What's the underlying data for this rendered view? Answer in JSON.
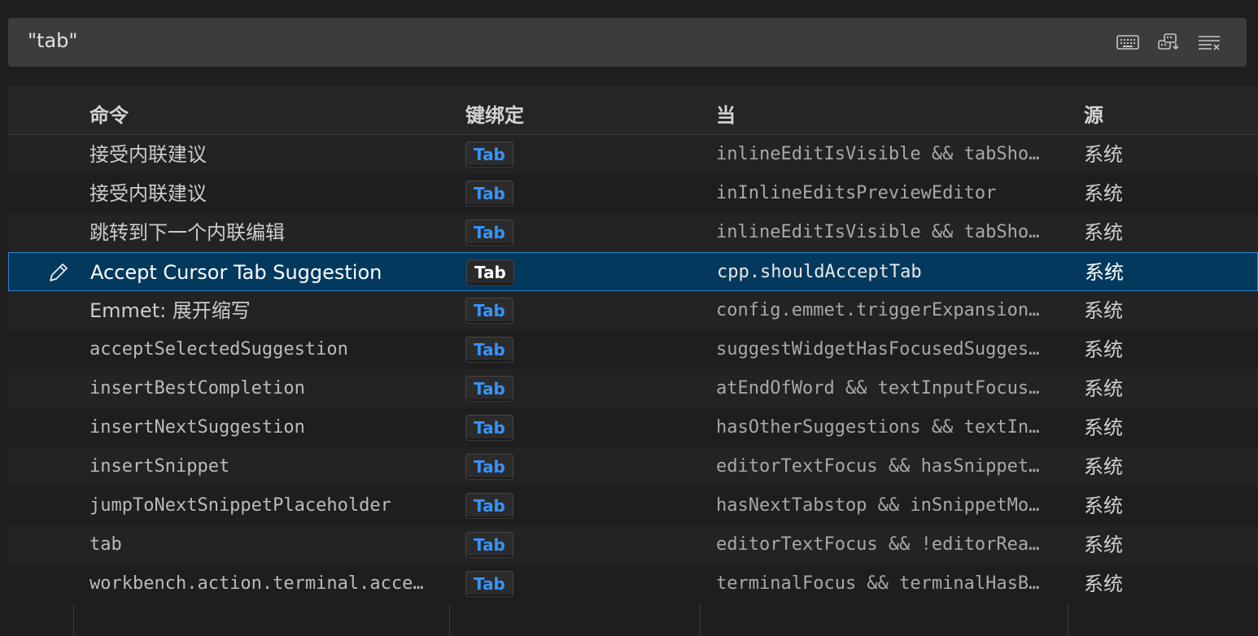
{
  "search": {
    "value": "\"tab\"",
    "record_keys_icon": "keyboard-icon",
    "sort_by_precedence_icon": "sort-precedence-icon",
    "clear_icon": "clear-filter-icon"
  },
  "table": {
    "headers": {
      "command": "命令",
      "keybinding": "键绑定",
      "when": "当",
      "source": "源"
    },
    "rows": [
      {
        "command": "接受内联建议",
        "key": "Tab",
        "when": "inlineEditIsVisible && tabSho…",
        "source": "系统"
      },
      {
        "command": "接受内联建议",
        "key": "Tab",
        "when": "inInlineEditsPreviewEditor",
        "source": "系统"
      },
      {
        "command": "跳转到下一个内联编辑",
        "key": "Tab",
        "when": "inlineEditIsVisible && tabSho…",
        "source": "系统"
      },
      {
        "command": "Accept Cursor Tab Suggestion",
        "key": "Tab",
        "when": "cpp.shouldAcceptTab",
        "source": "系统"
      },
      {
        "command": "Emmet: 展开缩写",
        "key": "Tab",
        "when": "config.emmet.triggerExpansion…",
        "source": "系统"
      },
      {
        "command": "acceptSelectedSuggestion",
        "key": "Tab",
        "when": "suggestWidgetHasFocusedSugges…",
        "source": "系统"
      },
      {
        "command": "insertBestCompletion",
        "key": "Tab",
        "when": "atEndOfWord && textInputFocus…",
        "source": "系统"
      },
      {
        "command": "insertNextSuggestion",
        "key": "Tab",
        "when": "hasOtherSuggestions && textIn…",
        "source": "系统"
      },
      {
        "command": "insertSnippet",
        "key": "Tab",
        "when": "editorTextFocus && hasSnippet…",
        "source": "系统"
      },
      {
        "command": "jumpToNextSnippetPlaceholder",
        "key": "Tab",
        "when": "hasNextTabstop && inSnippetMo…",
        "source": "系统"
      },
      {
        "command": "tab",
        "key": "Tab",
        "when": "editorTextFocus && !editorRea…",
        "source": "系统"
      },
      {
        "command": "workbench.action.terminal.acce…",
        "key": "Tab",
        "when": "terminalFocus && terminalHasB…",
        "source": "系统"
      }
    ]
  },
  "colors": {
    "background": "#1e1e1e",
    "selection": "#04395e",
    "focus_border": "#2f84d8",
    "key_label": "#3794ff"
  }
}
